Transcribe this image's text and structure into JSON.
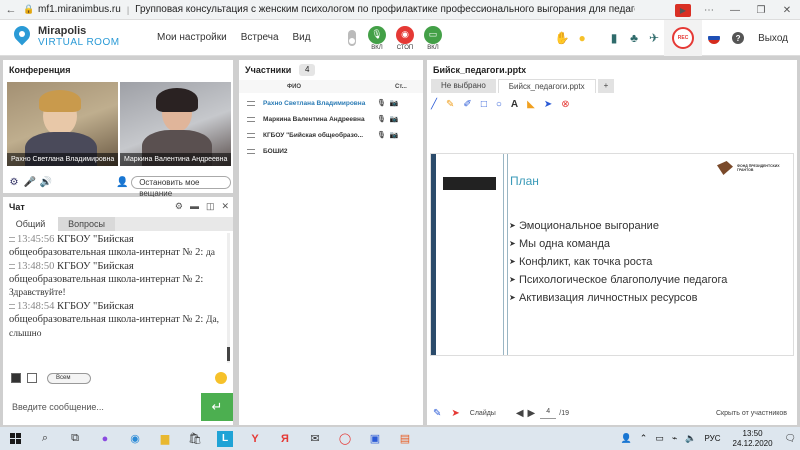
{
  "browser": {
    "url": "mf1.miranimbus.ru",
    "separator": "|",
    "title": "Групповая консультация с женским психологом по профилактике профессионального выгорания для педагогов"
  },
  "app": {
    "logo_top": "Mirapolis",
    "logo_bottom": "VIRTUAL ROOM",
    "menu": [
      "Мои настройки",
      "Встреча",
      "Вид"
    ],
    "controls": [
      {
        "label": "ВКЛ",
        "color": "#43a047",
        "icon": "microphone-icon"
      },
      {
        "label": "СТОП",
        "color": "#e53935",
        "icon": "camera-icon"
      },
      {
        "label": "ВКЛ",
        "color": "#43a047",
        "icon": "screen-share-icon"
      }
    ],
    "rec_label": "REC",
    "exit_label": "Выход",
    "accent": "#2a9ad6"
  },
  "conference": {
    "title": "Конференция",
    "videos": [
      {
        "name": "Рахно Светлана  Владимировна"
      },
      {
        "name": "Маркина Валентина  Андреевна"
      }
    ],
    "stop_button": "Остановить мое вещание"
  },
  "chat": {
    "title": "Чат",
    "tabs": [
      "Общий",
      "Вопросы"
    ],
    "messages": [
      {
        "time": "13:45:56",
        "author": "КГБОУ \"Бийская общеобразовательная школа-интернат № 2",
        "text": "да"
      },
      {
        "time": "13:48:50",
        "author": "КГБОУ \"Бийская общеобразовательная школа-интернат № 2",
        "text": "Здравствуйте!"
      },
      {
        "time": "13:48:54",
        "author": "КГБОУ \"Бийская общеобразовательная школа-интернат № 2",
        "text": "Да, слышно"
      }
    ],
    "recipient": "Всем",
    "input_placeholder": "Введите сообщение...",
    "send_color": "#4caf50"
  },
  "participants": {
    "title": "Участники",
    "count": "4",
    "col_name": "ФИО",
    "col_status": "Ст...",
    "rows": [
      {
        "name": "Рахно Светлана  Владимировна",
        "highlight": true
      },
      {
        "name": "Маркина Валентина  Андреевна",
        "highlight": false
      },
      {
        "name": "КГБОУ \"Бийская общеобразо...",
        "highlight": false
      },
      {
        "name": "БОШИ2",
        "highlight": false
      }
    ]
  },
  "presentation": {
    "title": "Бийск_педагоги.pptx",
    "tabs": [
      "Не выбрано",
      "Бийск_педагоги.pptx",
      "+"
    ],
    "slide": {
      "heading": "План",
      "logo_text": "ФОНД ПРЕЗИДЕНТСКИХ ГРАНТОВ",
      "bullets": [
        "Эмоциональное выгорание",
        "Мы одна команда",
        "Конфликт, как точка роста",
        "Психологическое благополучие педагога",
        "Активизация личностных ресурсов"
      ]
    },
    "footer": {
      "slides_label": "Слайды",
      "current_page": "4",
      "total_pages": "/19",
      "hide_label": "Скрыть от участников"
    }
  },
  "taskbar": {
    "lang": "РУС",
    "time": "13:50",
    "date": "24.12.2020"
  }
}
